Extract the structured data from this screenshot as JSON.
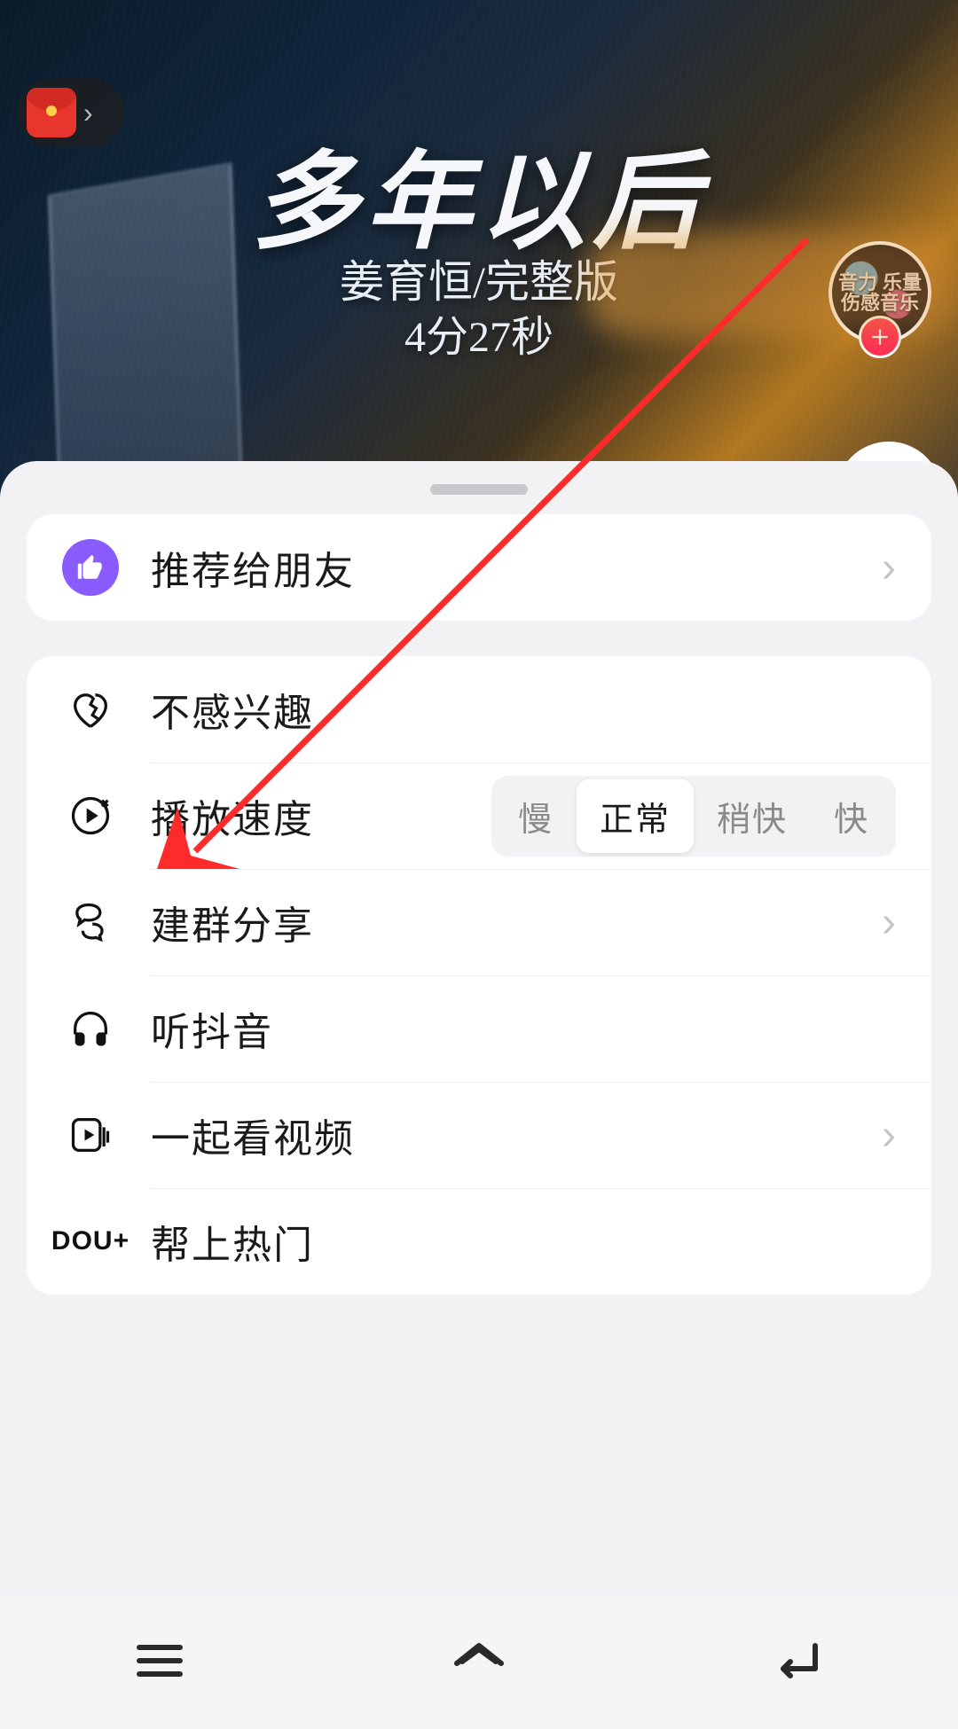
{
  "video": {
    "title": "多年以后",
    "subtitle": "姜育恒/完整版",
    "duration": "4分27秒",
    "avatar_text": "音力\n乐量\n伤感音乐"
  },
  "sheet": {
    "recommend_label": "推荐给朋友",
    "not_interested_label": "不感兴趣",
    "speed_label": "播放速度",
    "speed_options": {
      "slow": "慢",
      "normal": "正常",
      "bit_fast": "稍快",
      "fast": "快"
    },
    "group_share_label": "建群分享",
    "listen_label": "听抖音",
    "watch_together_label": "一起看视频",
    "dou_plus_label": "帮上热门",
    "dou_plus_icon_text": "DOU+"
  }
}
